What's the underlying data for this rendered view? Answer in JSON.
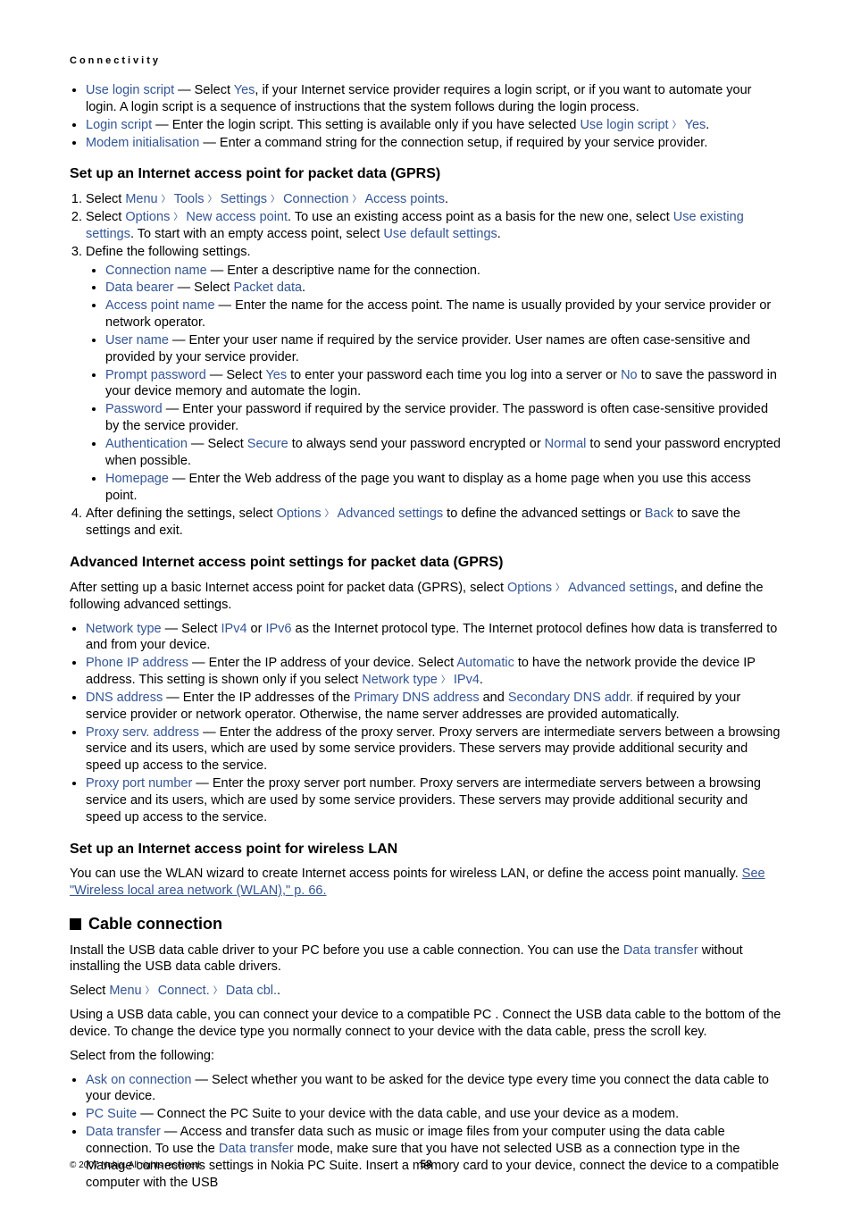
{
  "header": {
    "chapter": "Connectivity"
  },
  "intro_bullets": [
    {
      "term": "Use login script",
      "pre": " — Select ",
      "mid": "Yes",
      "post": ", if your Internet service provider requires a login script, or if you want to automate your login. A login script is a sequence of instructions that the system follows during the login process."
    },
    {
      "term": "Login script",
      "pre": " — Enter the login script. This setting is available only if you have selected ",
      "path_a": "Use login script",
      "path_b": "Yes",
      "post": "."
    },
    {
      "term": "Modem initialisation",
      "pre": " — Enter a command string for the connection setup, if required by your service provider."
    }
  ],
  "gprs": {
    "title": "Set up an Internet access point for packet data (GPRS)",
    "step1": {
      "prefix": "Select ",
      "parts": [
        "Menu",
        "Tools",
        "Settings",
        "Connection",
        "Access points"
      ],
      "suffix": "."
    },
    "step2": {
      "select": "Select ",
      "opt": "Options",
      "nap": "New access point",
      "mid": ". To use an existing access point as a basis for the new one, select ",
      "ues": "Use existing settings",
      "mid2": ". To start with an empty access point, select ",
      "uds": "Use default settings",
      "end": "."
    },
    "step3": {
      "lead": "Define the following settings.",
      "subs": {
        "conn_name": {
          "term": "Connection name",
          "txt": " — Enter a descriptive name for the connection."
        },
        "data_bearer": {
          "term": "Data bearer",
          "pre": " — Select ",
          "val": "Packet data",
          "post": "."
        },
        "apn": {
          "term": "Access point name",
          "txt": " — Enter the name for the access point. The name is usually provided by your service provider or network operator."
        },
        "user": {
          "term": "User name",
          "txt": " — Enter your user name if required by the service provider. User names are often case-sensitive and provided by your service provider."
        },
        "pp": {
          "term": "Prompt password",
          "pre": " — Select ",
          "yes": "Yes",
          "mid": " to enter your password each time you log into a server or ",
          "no": "No",
          "post": " to save the password in your device memory and automate the login."
        },
        "pw": {
          "term": "Password",
          "txt": " — Enter your password if required by the service provider. The password is often case-sensitive provided by the service provider."
        },
        "auth": {
          "term": "Authentication",
          "pre": " — Select ",
          "sec": "Secure",
          "mid": " to always send your password encrypted or ",
          "norm": "Normal",
          "post": " to send your password encrypted when possible."
        },
        "home": {
          "term": "Homepage",
          "txt": " — Enter the Web address of the page you want to display as a home page when you use this access point."
        }
      }
    },
    "step4": {
      "pre": "After defining the settings, select ",
      "opt": "Options",
      "adv": "Advanced settings",
      "mid": " to define the advanced settings or ",
      "back": "Back",
      "post": " to save the settings and exit."
    }
  },
  "advanced": {
    "title": "Advanced Internet access point settings for packet data (GPRS)",
    "lead": {
      "pre": "After setting up a basic Internet access point for packet data (GPRS), select ",
      "opt": "Options",
      "adv": "Advanced settings",
      "post": ", and define the following advanced settings."
    },
    "nt": {
      "term": "Network type",
      "pre": " — Select ",
      "v4": "IPv4",
      "or": " or ",
      "v6": "IPv6",
      "post": " as the Internet protocol type. The Internet protocol defines how data is transferred to and from your device."
    },
    "pip": {
      "term": "Phone IP address",
      "pre": " — Enter the IP address of your device. Select ",
      "auto": "Automatic",
      "mid": " to have the network provide the device IP address. This setting is shown only if you select ",
      "nt": "Network type",
      "v4": "IPv4",
      "post": "."
    },
    "dns": {
      "term": "DNS address",
      "pre": " — Enter the IP addresses of the ",
      "p": "Primary DNS address",
      "and": " and ",
      "s": "Secondary DNS addr.",
      "post": " if required by your service provider or network operator. Otherwise, the name server addresses are provided automatically."
    },
    "proxy": {
      "term": "Proxy serv. address",
      "txt": " — Enter the address of the proxy server. Proxy servers are intermediate servers between a browsing service and its users, which are used by some service providers. These servers may provide additional security and speed up access to the service."
    },
    "port": {
      "term": "Proxy port number",
      "txt": " — Enter the proxy server port number. Proxy servers are intermediate servers between a browsing service and its users, which are used by some service providers. These servers may provide additional security and speed up access to the service."
    }
  },
  "wlan": {
    "title": "Set up an Internet access point for wireless LAN",
    "pre": "You can use the WLAN wizard to create Internet access points for wireless LAN, or define the access point manually. ",
    "link": "See \"Wireless local area network (WLAN),\" p. 66."
  },
  "cable": {
    "title": "Cable connection",
    "p1": {
      "pre": "Install the USB data cable driver to your PC before you use a cable connection. You can use the ",
      "dt": "Data transfer",
      "post": " without installing the USB data cable drivers."
    },
    "p2": {
      "pre": "Select ",
      "a": "Menu",
      "b": "Connect.",
      "c": "Data cbl.",
      "post": "."
    },
    "p3": "Using a USB data cable, you can connect your device to a compatible PC . Connect the USB data cable to the bottom of the device. To change the device type you normally connect to your device with the data cable, press the scroll key.",
    "p4": "Select from the following:",
    "aoc": {
      "term": "Ask on connection",
      "txt": " — Select whether you want to be asked for the device type every time you connect the data cable to your device."
    },
    "pcs": {
      "term": "PC Suite",
      "txt": " — Connect the PC Suite to your device with the data cable, and use your device as a modem."
    },
    "dt": {
      "term": "Data transfer",
      "pre": " — Access and transfer data such as music or image files from your computer using the data cable connection. To use the ",
      "dt": "Data transfer",
      "post": " mode, make sure that you have not selected USB as a connection type in the Manage connections settings in Nokia PC Suite. Insert a memory card to your device, connect the device to a compatible computer with the USB"
    }
  },
  "footer": {
    "copyright": "© 2007 Nokia. All rights reserved.",
    "page": "58"
  }
}
